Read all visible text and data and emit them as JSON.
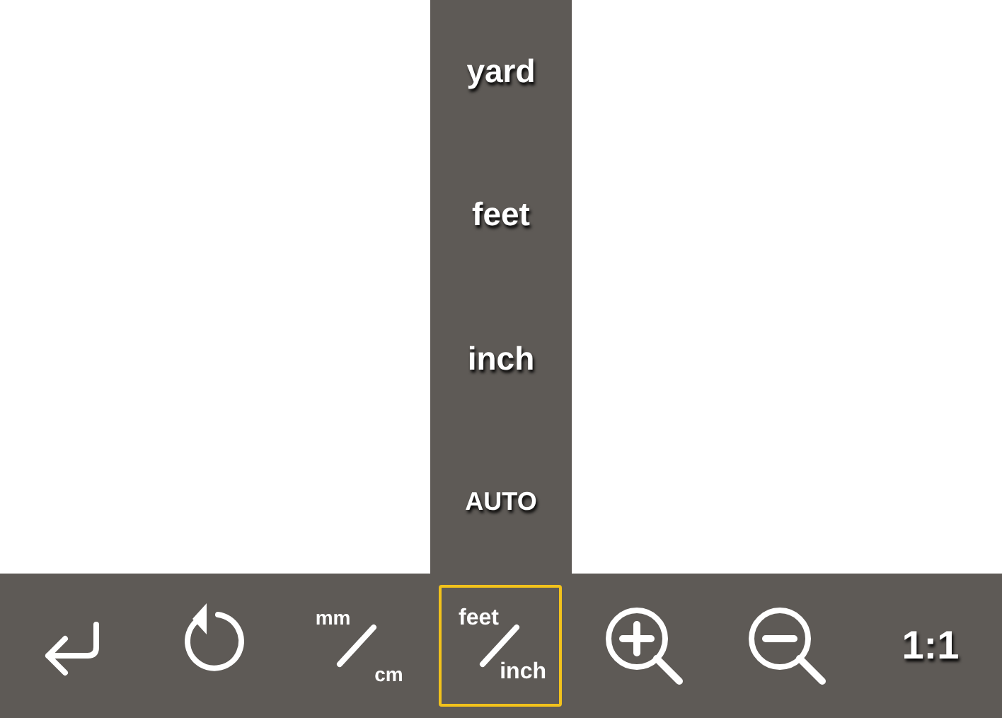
{
  "unit_menu": [
    {
      "label": "yard"
    },
    {
      "label": "feet"
    },
    {
      "label": "inch"
    },
    {
      "label": "AUTO"
    }
  ],
  "toolbar": [
    {
      "kind": "back",
      "selected": false
    },
    {
      "kind": "rotate",
      "selected": false
    },
    {
      "kind": "fraction",
      "top": "mm",
      "bottom": "cm",
      "selected": false
    },
    {
      "kind": "fraction",
      "top": "feet",
      "bottom": "inch",
      "selected": true
    },
    {
      "kind": "zoom-in",
      "selected": false
    },
    {
      "kind": "zoom-out",
      "selected": false
    },
    {
      "kind": "text",
      "label": "1:1",
      "selected": false
    }
  ]
}
